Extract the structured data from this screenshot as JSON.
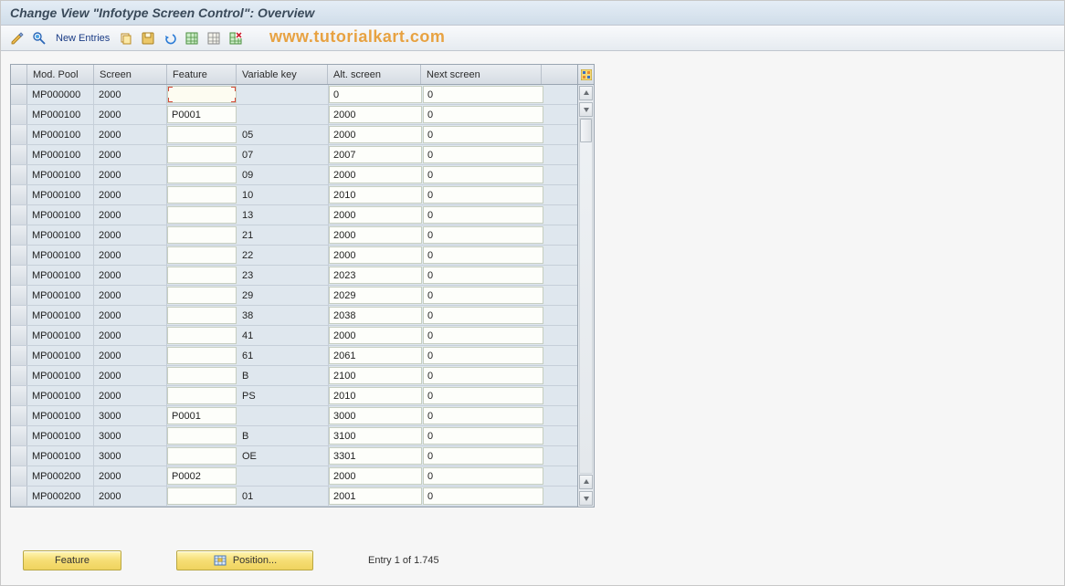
{
  "title": "Change View \"Infotype Screen Control\": Overview",
  "watermark": "www.tutorialkart.com",
  "toolbar": {
    "new_entries": "New Entries"
  },
  "table": {
    "headers": {
      "mod_pool": "Mod. Pool",
      "screen": "Screen",
      "feature": "Feature",
      "variable_key": "Variable key",
      "alt_screen": "Alt. screen",
      "next_screen": "Next screen"
    },
    "rows": [
      {
        "mod": "MP000000",
        "scr": "2000",
        "feat": "",
        "vkey": "",
        "alt": "0",
        "next": "0"
      },
      {
        "mod": "MP000100",
        "scr": "2000",
        "feat": "P0001",
        "vkey": "",
        "alt": "2000",
        "next": "0"
      },
      {
        "mod": "MP000100",
        "scr": "2000",
        "feat": "",
        "vkey": "05",
        "alt": "2000",
        "next": "0"
      },
      {
        "mod": "MP000100",
        "scr": "2000",
        "feat": "",
        "vkey": "07",
        "alt": "2007",
        "next": "0"
      },
      {
        "mod": "MP000100",
        "scr": "2000",
        "feat": "",
        "vkey": "09",
        "alt": "2000",
        "next": "0"
      },
      {
        "mod": "MP000100",
        "scr": "2000",
        "feat": "",
        "vkey": "10",
        "alt": "2010",
        "next": "0"
      },
      {
        "mod": "MP000100",
        "scr": "2000",
        "feat": "",
        "vkey": "13",
        "alt": "2000",
        "next": "0"
      },
      {
        "mod": "MP000100",
        "scr": "2000",
        "feat": "",
        "vkey": "21",
        "alt": "2000",
        "next": "0"
      },
      {
        "mod": "MP000100",
        "scr": "2000",
        "feat": "",
        "vkey": "22",
        "alt": "2000",
        "next": "0"
      },
      {
        "mod": "MP000100",
        "scr": "2000",
        "feat": "",
        "vkey": "23",
        "alt": "2023",
        "next": "0"
      },
      {
        "mod": "MP000100",
        "scr": "2000",
        "feat": "",
        "vkey": "29",
        "alt": "2029",
        "next": "0"
      },
      {
        "mod": "MP000100",
        "scr": "2000",
        "feat": "",
        "vkey": "38",
        "alt": "2038",
        "next": "0"
      },
      {
        "mod": "MP000100",
        "scr": "2000",
        "feat": "",
        "vkey": "41",
        "alt": "2000",
        "next": "0"
      },
      {
        "mod": "MP000100",
        "scr": "2000",
        "feat": "",
        "vkey": "61",
        "alt": "2061",
        "next": "0"
      },
      {
        "mod": "MP000100",
        "scr": "2000",
        "feat": "",
        "vkey": "B",
        "alt": "2100",
        "next": "0"
      },
      {
        "mod": "MP000100",
        "scr": "2000",
        "feat": "",
        "vkey": "PS",
        "alt": "2010",
        "next": "0"
      },
      {
        "mod": "MP000100",
        "scr": "3000",
        "feat": "P0001",
        "vkey": "",
        "alt": "3000",
        "next": "0"
      },
      {
        "mod": "MP000100",
        "scr": "3000",
        "feat": "",
        "vkey": "B",
        "alt": "3100",
        "next": "0"
      },
      {
        "mod": "MP000100",
        "scr": "3000",
        "feat": "",
        "vkey": "OE",
        "alt": "3301",
        "next": "0"
      },
      {
        "mod": "MP000200",
        "scr": "2000",
        "feat": "P0002",
        "vkey": "",
        "alt": "2000",
        "next": "0"
      },
      {
        "mod": "MP000200",
        "scr": "2000",
        "feat": "",
        "vkey": "01",
        "alt": "2001",
        "next": "0"
      }
    ]
  },
  "footer": {
    "feature_button": "Feature",
    "position_button": "Position...",
    "status": "Entry 1 of 1.745"
  }
}
